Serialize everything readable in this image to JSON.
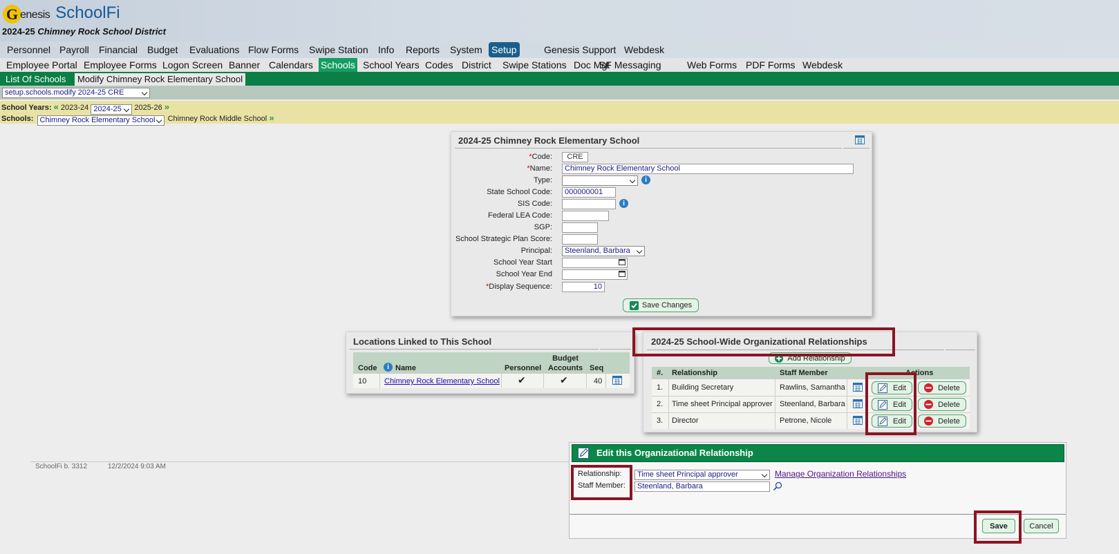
{
  "header": {
    "logo_letter": "G",
    "logo_word": "enesis",
    "app_name": "SchoolFi",
    "year": "2024-25",
    "district": "Chimney Rock School District"
  },
  "topnav": [
    "Personnel",
    "Payroll",
    "Financial",
    "Budget",
    "Evaluations",
    "Flow Forms",
    "Swipe Station",
    "Info",
    "Reports",
    "System",
    "Setup",
    "Genesis Support",
    "Webdesk"
  ],
  "topnav_active": "Setup",
  "subnav": [
    "Employee Portal",
    "Employee Forms",
    "Logon Screen",
    "Banner",
    "Calendars",
    "Schools",
    "School Years",
    "Codes",
    "District",
    "Swipe Stations",
    "Doc Mgt",
    "SF Messaging",
    "Web Forms",
    "PDF Forms",
    "Webdesk"
  ],
  "subnav_active": "Schools",
  "tabs": {
    "list": "List Of Schools",
    "modify": "Modify Chimney Rock Elementary School"
  },
  "page_select": "setup.schools.modify 2024-25 CRE",
  "school_years": {
    "label": "School Years:",
    "prev": "2023-24",
    "current": "2024-25",
    "next": "2025-26"
  },
  "schools": {
    "label": "Schools:",
    "current": "Chimney Rock Elementary School",
    "next": "Chimney Rock Middle School"
  },
  "school_form": {
    "title": "2024-25 Chimney Rock Elementary School",
    "code_label": "Code:",
    "code": "CRE",
    "name_label": "Name:",
    "name": "Chimney Rock Elementary School",
    "type_label": "Type:",
    "type": "",
    "state_code_label": "State School Code:",
    "state_code": "000000001",
    "sis_label": "SIS Code:",
    "sis": "",
    "lea_label": "Federal LEA Code:",
    "lea": "",
    "sgp_label": "SGP:",
    "sgp": "",
    "plan_label": "School Strategic Plan Score:",
    "plan": "",
    "principal_label": "Principal:",
    "principal": "Steenland, Barbara",
    "year_start_label": "School Year Start",
    "year_start": "",
    "year_end_label": "School Year End",
    "year_end": "",
    "display_seq_label": "Display Sequence:",
    "display_seq": "10",
    "save_label": "Save Changes"
  },
  "locations": {
    "title": "Locations Linked to This School",
    "headers": {
      "code": "Code",
      "name": "Name",
      "personnel": "Personnel",
      "budget": "Budget\nAccounts",
      "seq": "Seq"
    },
    "rows": [
      {
        "code": "10",
        "name": "Chimney Rock Elementary School",
        "personnel": "✔",
        "budget": "✔",
        "seq": "40"
      }
    ]
  },
  "relationships": {
    "title": "2024-25 School-Wide Organizational Relationships",
    "add_label": "Add Relationship",
    "headers": {
      "num": "#.",
      "relationship": "Relationship",
      "staff": "Staff Member",
      "actions": "Actions"
    },
    "rows": [
      {
        "num": "1.",
        "relationship": "Building Secretary",
        "staff": "Rawlins, Samantha"
      },
      {
        "num": "2.",
        "relationship": "Time sheet Principal approver",
        "staff": "Steenland, Barbara"
      },
      {
        "num": "3.",
        "relationship": "Director",
        "staff": "Petrone, Nicole"
      }
    ],
    "edit_label": "Edit",
    "delete_label": "Delete"
  },
  "footer": {
    "build": "SchoolFi b. 3312",
    "datetime": "12/2/2024 9:03 AM"
  },
  "dialog": {
    "title": "Edit this Organizational Relationship",
    "relationship_label": "Relationship:",
    "relationship_value": "Time sheet Principal approver",
    "manage_link": "Manage Organization Relationships",
    "staff_label": "Staff Member:",
    "staff_value": "Steenland, Barbara",
    "save_label": "Save",
    "cancel_label": "Cancel"
  },
  "colors": {
    "accent_green": "#0b8648",
    "nav_blue": "#1a5e8c",
    "highlight": "#8c1422",
    "yellow_bar": "#e8e3a4"
  }
}
